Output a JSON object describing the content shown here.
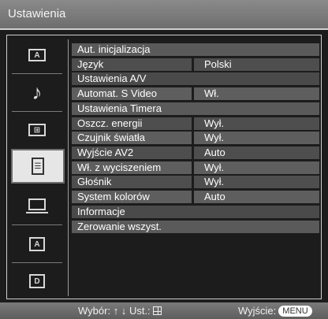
{
  "title": "Ustawienia",
  "sidebar": {
    "items": [
      {
        "name": "picture-icon",
        "glyph": "A"
      },
      {
        "name": "music-note-icon",
        "glyph": "♪"
      },
      {
        "name": "screen-icon",
        "glyph": "⊞"
      },
      {
        "name": "settings-list-icon",
        "glyph": "☰",
        "active": true
      },
      {
        "name": "pc-icon",
        "glyph": ""
      },
      {
        "name": "analog-tv-icon",
        "glyph": "A"
      },
      {
        "name": "digital-tv-icon",
        "glyph": "D"
      }
    ]
  },
  "menu": {
    "rows": [
      {
        "label": "Aut. inicjalizacja",
        "value": ""
      },
      {
        "label": "Język",
        "value": "Polski"
      },
      {
        "label": "Ustawienia A/V",
        "value": ""
      },
      {
        "label": "Automat. S Video",
        "value": "Wł."
      },
      {
        "label": "Ustawienia Timera",
        "value": ""
      },
      {
        "label": "Oszcz. energii",
        "value": "Wył."
      },
      {
        "label": "Czujnik światła",
        "value": "Wył."
      },
      {
        "label": "Wyjście AV2",
        "value": "Auto"
      },
      {
        "label": "Wł. z wyciszeniem",
        "value": "Wył."
      },
      {
        "label": "Głośnik",
        "value": "Wył."
      },
      {
        "label": "System kolorów",
        "value": "Auto"
      },
      {
        "label": "Informacje",
        "value": ""
      },
      {
        "label": "Zerowanie wszyst.",
        "value": ""
      }
    ]
  },
  "footer": {
    "select_text": "Wybór:",
    "arrows": "↑ ↓",
    "set_text": "Ust.:",
    "exit_text": "Wyjście:",
    "menu_button": "MENU"
  }
}
